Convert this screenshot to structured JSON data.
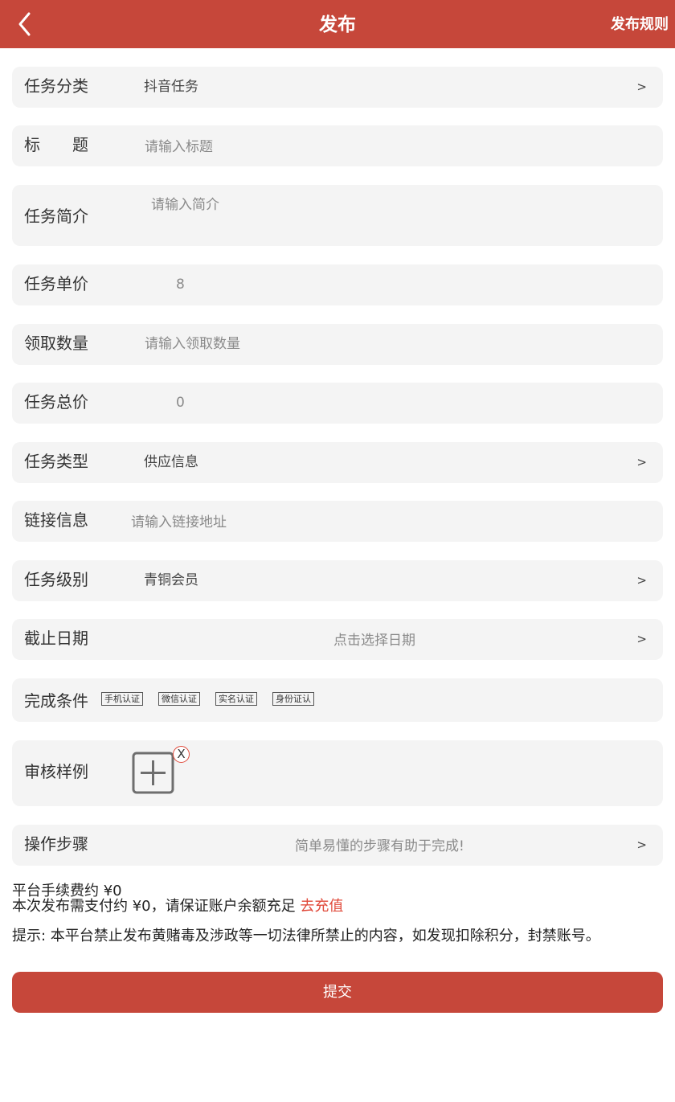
{
  "header": {
    "title": "发布",
    "rules_link": "发布规则"
  },
  "form": {
    "category": {
      "label": "任务分类",
      "value": "抖音任务",
      "arrow": ">"
    },
    "title": {
      "label": "标　　题",
      "placeholder": "请输入标题"
    },
    "intro": {
      "label": "任务简介",
      "placeholder": "请输入简介"
    },
    "unit_price": {
      "label": "任务单价",
      "value": "8"
    },
    "quantity": {
      "label": "领取数量",
      "placeholder": "请输入领取数量"
    },
    "total_price": {
      "label": "任务总价",
      "value": "0"
    },
    "task_type": {
      "label": "任务类型",
      "value": "供应信息",
      "arrow": ">"
    },
    "link": {
      "label": "链接信息",
      "placeholder": "请输入链接地址"
    },
    "level": {
      "label": "任务级别",
      "value": "青铜会员",
      "arrow": ">"
    },
    "deadline": {
      "label": "截止日期",
      "placeholder": "点击选择日期",
      "arrow": ">"
    },
    "conditions": {
      "label": "完成条件",
      "tags": [
        "手机认证",
        "微信认证",
        "实名认证",
        "身份证认"
      ]
    },
    "sample": {
      "label": "审核样例",
      "remove_glyph": "X"
    },
    "steps": {
      "label": "操作步骤",
      "placeholder": "简单易懂的步骤有助于完成!",
      "arrow": ">"
    }
  },
  "info": {
    "fee": "平台手续费约 ¥0",
    "pay": "本次发布需支付约 ¥0，请保证账户余额充足",
    "recharge": "去充值",
    "notice": "提示: 本平台禁止发布黄赌毒及涉政等一切法律所禁止的内容，如发现扣除积分，封禁账号。"
  },
  "submit_label": "提交",
  "colors": {
    "brand": "#c6473a",
    "row_bg": "#f4f4f4",
    "link": "#e0493a"
  }
}
